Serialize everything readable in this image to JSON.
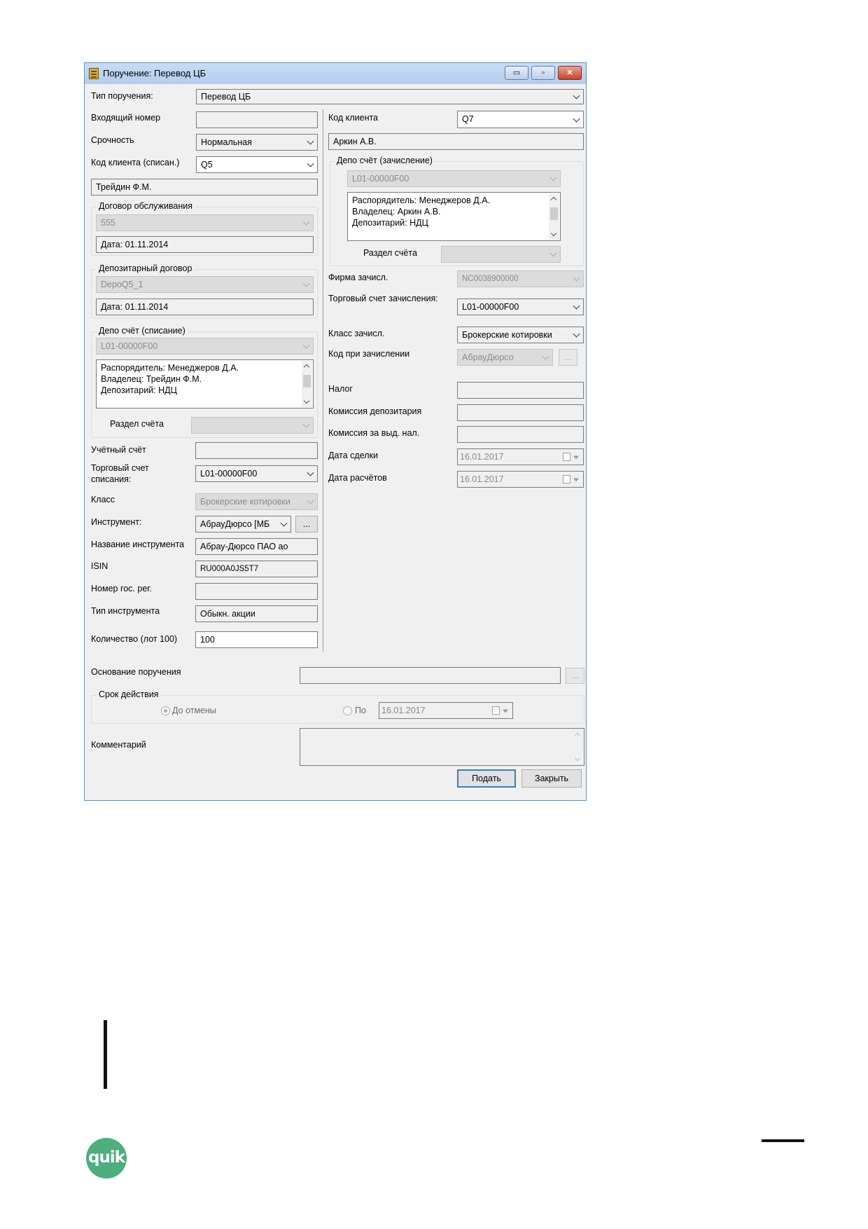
{
  "window": {
    "title": "Поручение: Перевод ЦБ",
    "minimize_glyph": "▭",
    "maximize_glyph": "▫",
    "close_glyph": "✕"
  },
  "left": {
    "order_type": {
      "label": "Тип поручения:",
      "value": "Перевод ЦБ"
    },
    "incoming_number": {
      "label": "Входящий номер",
      "value": ""
    },
    "urgency": {
      "label": "Срочность",
      "value": "Нормальная"
    },
    "client_code_debit": {
      "label": "Код клиента (списан.)",
      "value": "Q5"
    },
    "client_name_debit": "Трейдин Ф.М.",
    "service_contract": {
      "title": "Договор обслуживания",
      "value": "555",
      "date": "Дата: 01.11.2014"
    },
    "depo_contract": {
      "title": "Депозитарный договор",
      "value": "DepoQ5_1",
      "date": "Дата: 01.11.2014"
    },
    "depo_account_debit": {
      "title": "Депо счёт (списание)",
      "value": "L01-00000F00",
      "info": [
        "Распорядитель: Менеджеров Д.А.",
        "Владелец: Трейдин Ф.М.",
        "Депозитарий: НДЦ"
      ],
      "section_label": "Раздел счёта",
      "section_value": ""
    },
    "accounting_account": {
      "label": "Учётный счёт",
      "value": ""
    },
    "trade_account_debit": {
      "label1": "Торговый счет",
      "label2": "списания:",
      "value": "L01-00000F00"
    },
    "class": {
      "label": "Класс",
      "value": "Брокерские котировки"
    },
    "instrument": {
      "label": "Инструмент:",
      "value": "АбрауДюрсо [МБ",
      "more": "..."
    },
    "instrument_name": {
      "label": "Название инструмента",
      "value": "Абрау-Дюрсо ПАО ао"
    },
    "isin": {
      "label": "ISIN",
      "value": "RU000A0JS5T7"
    },
    "state_reg": {
      "label": "Номер гос. рег.",
      "value": ""
    },
    "instrument_type": {
      "label": "Тип инструмента",
      "value": "Обыкн. акции"
    },
    "quantity": {
      "label": "Количество (лот 100)",
      "value": "100"
    }
  },
  "right": {
    "client_code": {
      "label": "Код клиента",
      "value": "Q7"
    },
    "client_name": "Аркин А.В.",
    "depo_account_credit": {
      "title": "Депо счёт (зачисление)",
      "value": "L01-00000F00",
      "info": [
        "Распорядитель: Менеджеров Д.А.",
        "Владелец: Аркин А.В.",
        "Депозитарий: НДЦ"
      ],
      "section_label": "Раздел счёта",
      "section_value": ""
    },
    "firm_credit": {
      "label": "Фирма зачисл.",
      "value": "NC0038900000"
    },
    "trade_account_credit": {
      "label": "Торговый счет зачисления:",
      "value": "L01-00000F00"
    },
    "class_credit": {
      "label": "Класс зачисл.",
      "value": "Брокерские котировки"
    },
    "code_credit": {
      "label": "Код при зачислении",
      "value": "АбрауДюрсо",
      "more": "..."
    },
    "tax": {
      "label": "Налог",
      "value": ""
    },
    "depo_commission": {
      "label": "Комиссия депозитария",
      "value": ""
    },
    "commission_tax": {
      "label": "Комиссия за выд. нал.",
      "value": ""
    },
    "trade_date": {
      "label": "Дата сделки",
      "value": "16.01.2017"
    },
    "settlement_date": {
      "label": "Дата расчётов",
      "value": "16.01.2017"
    }
  },
  "bottom": {
    "basis": {
      "label": "Основание поручения",
      "value": "",
      "more": "..."
    },
    "validity": {
      "title": "Срок действия",
      "until_cancel": "До отмены",
      "until_date_label": "По",
      "until_date": "16.01.2017"
    },
    "comment": {
      "label": "Комментарий",
      "value": ""
    },
    "submit": "Подать",
    "close": "Закрыть"
  },
  "page": {
    "logo_text": "quik"
  }
}
